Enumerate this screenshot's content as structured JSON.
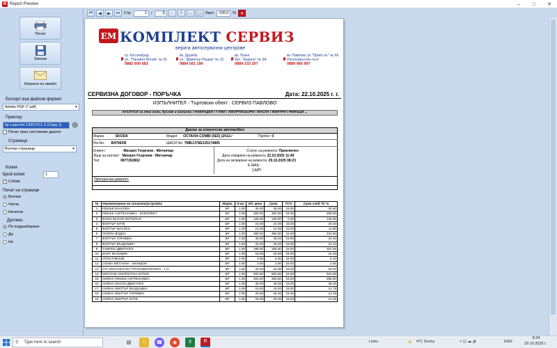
{
  "window": {
    "title": "Report Preview"
  },
  "left_panel": {
    "print_label": "Печат",
    "save_label": "Запази",
    "email_label": "Изпрати по имейл",
    "export_label": "Експорт във файлов формат",
    "export_value": "Adobe PDF (*.pdf)",
    "printer_label": "Принтер",
    "printer_value": "hp LaserJet 1320 PCL 5 (Copy 1)",
    "print_dialog_label": "Печат през системния диалог",
    "pages_label": "Страници",
    "pages_value": "Всички страници",
    "copies_label": "Копия",
    "copies_count_label": "Брой копия",
    "copies_value": "1",
    "collate_label": "Collate",
    "print_pages_label": "Печат на страници",
    "pp_options": [
      "Всички",
      "Четни",
      "Нечетни"
    ],
    "duplex_label": "Дуплекс",
    "duplex_options": [
      "По подразбиране",
      "Да",
      "Не"
    ]
  },
  "toolbar": {
    "page_label": "Стр.",
    "page_value": "1",
    "page_total": "3",
    "zoom_label": "Увел.",
    "zoom_value": "100.0",
    "zoom_unit": "%"
  },
  "doc": {
    "brand_em": "ЕМ",
    "brand_part1": "КОМПЛЕКТ",
    "brand_part2": "СЕРВИЗ",
    "brand_sub": "верига автосервизни центрове",
    "branches": [
      {
        "l1": "гр. Костинброд",
        "l2": "ул. \"Панайот Волов\" № 55",
        "phone": "0882 600 583"
      },
      {
        "l1": "кв. Дружба",
        "l2": "ул. \"Димитър Пешев\" № 15",
        "phone": "0884 561 196"
      },
      {
        "l1": "кв. Лозен",
        "l2": "бул. \"Европа\" № 6А",
        "phone": "0884 233 297"
      },
      {
        "l1": "кв. Павлово ул.\"Пряко пъ\" № 66",
        "l2": "/Околовръстен път/",
        "phone": "0889 966 997"
      }
    ],
    "title": "СЕРВИЗНА ДОГОВОР - ПОРЪЧКА",
    "date": "Дата: 22.10.2025 г. г.",
    "executor": "ИЗПЪЛНИТЕЛ - Търговски обект : СЕРВИЗ ПАВЛОВО",
    "services": "АУСЛУСИ за леки коли, бусове и камиони /  НАКЛАДКИ / ГУМИ / АМОРТИСЬОРИ / МАСЛА / ФИЛТРИ / РЕМЪЦИ ...",
    "client_header": "Данни за клиентски автомобил",
    "make_label": "Марка:",
    "make": "SKODA",
    "model_label": "Модел:",
    "model": "OCTAVIA COMBI (5E5) (2012-/",
    "mileage_label": "Пробег:",
    "mileage": "0",
    "reg_label": "Рег.No:",
    "reg": "В4706ХВ",
    "vin_label": "ШАСИ No:",
    "vin": "TMBJJ7NE3J0174895",
    "client_label": "Клиент:",
    "client": "Михаил Георгиев - Митничар",
    "contact_label": "Лице за контакт:",
    "contact": "Михаил Георгиев - Митничар",
    "tel_label": "Тел:",
    "tel": "0877262862",
    "status_label": "Статус на ремонта:",
    "status": "Приключен",
    "opened_label": "Дата отваряне на ремонта:",
    "opened": "22.10.2025 11:49",
    "closed_label": "Дата на затваряне на ремонта:",
    "closed": "29.10.2025 08:23",
    "email_label": "E-MAIL:",
    "site_label": "САЙТ:",
    "remarks_label": "Препоръчан ремонт:",
    "columns": [
      "№",
      "Наименование на стоката/услугата",
      "Марка",
      "К-во",
      "Ед. цена",
      "Сума",
      "ТС%",
      "Сума след ТС %"
    ],
    "items": [
      [
        "1",
        "РЕМЪК КАНАЛЕН",
        "БР",
        "1.00",
        "36.00",
        "36.00",
        "15.00",
        "30.60"
      ],
      [
        "2",
        "РЕМЪК АНГРЕНАЖЕН - КОМПЛЕКТ",
        "БР",
        "1.00",
        "300.00",
        "300.00",
        "15.00",
        "255.00"
      ],
      [
        "3",
        "BVSIS МАСЛО МОТОРНО",
        "БР",
        "1.00",
        "125.00",
        "125.00",
        "0.00",
        "125.00"
      ],
      [
        "4",
        "ФИЛТЪР КУПЕ",
        "БР",
        "1.00",
        "24.00",
        "24.00",
        "15.00",
        "20.40"
      ],
      [
        "5",
        "ФИЛТЪР МАСЛЕН",
        "БР",
        "1.00",
        "14.00",
        "14.00",
        "15.00",
        "11.90"
      ],
      [
        "6",
        "ПОМПА ВОДНА",
        "БР",
        "1.00",
        "390.00",
        "390.00",
        "15.00",
        "331.50"
      ],
      [
        "7",
        "ФИЛТЪР ГОРИВЕН",
        "БР",
        "1.00",
        "38.00",
        "38.00",
        "15.00",
        "32.30"
      ],
      [
        "8",
        "ФИЛТЪР ВЪЗДУШЕН",
        "БР",
        "1.00",
        "26.00",
        "26.00",
        "15.00",
        "22.10"
      ],
      [
        "9",
        "ТАМПОН ДВИГАТЕЛ",
        "БР",
        "1.00",
        "185.00",
        "185.00",
        "15.00",
        "157.25"
      ],
      [
        "10",
        "БОЛТ МАХОВИК",
        "БР",
        "1.00",
        "18.00",
        "18.00",
        "15.00",
        "15.30"
      ],
      [
        "11",
        "УПЛЪТНЕНИЕ",
        "БР",
        "2.00",
        "3.00",
        "6.00",
        "15.00",
        "5.10"
      ],
      [
        "12",
        "СКОБА МЕТАЛНА - МАНШОН",
        "БР",
        "1.00",
        "3.00",
        "3.00",
        "15.00",
        "2.55"
      ],
      [
        "13",
        "ATF DSGII МАСЛО ТРАНСМИСИОННО - 1 Л.",
        "БР",
        "1.00",
        "24.00",
        "24.00",
        "15.00",
        "20.40"
      ],
      [
        "14",
        "МОНТАЖ СКОРОСТНА КУТИЯ",
        "БР",
        "1.00",
        "600.00",
        "600.00",
        "15.00",
        "510.00"
      ],
      [
        "15",
        "СМЯНА РЕМЪК АНГРЕНАЖЕН",
        "БР",
        "1.00",
        "300.00",
        "300.00",
        "15.00",
        "255.00"
      ],
      [
        "16",
        "СМЯНА МАСЛО ДВИГАТЕЛ",
        "БР",
        "1.00",
        "45.00",
        "45.00",
        "15.00",
        "38.25"
      ],
      [
        "17",
        "СМЯНА ФИЛТЪР ВЪЗДУШЕН",
        "БР",
        "1.00",
        "15.00",
        "15.00",
        "15.00",
        "12.75"
      ],
      [
        "18",
        "СМЯНА ФИЛТЪР ГОРИВЕН",
        "БР",
        "1.00",
        "25.00",
        "25.00",
        "15.00",
        "21.25"
      ],
      [
        "19",
        "СМЯНА ФИЛТЪР КУПЕ",
        "БР",
        "1.00",
        "25.00",
        "25.00",
        "15.00",
        "21.25"
      ]
    ]
  },
  "taskbar": {
    "search_placeholder": "Type here to search",
    "links": "Links",
    "weather": "4°C  Sunny",
    "lang": "ENG",
    "time": "8:24",
    "date": "29.10.2025 г."
  },
  "colors": {
    "brand_blue": "#1d3e92",
    "brand_red": "#c4161c",
    "panel_bg": "#c5d8ee"
  }
}
